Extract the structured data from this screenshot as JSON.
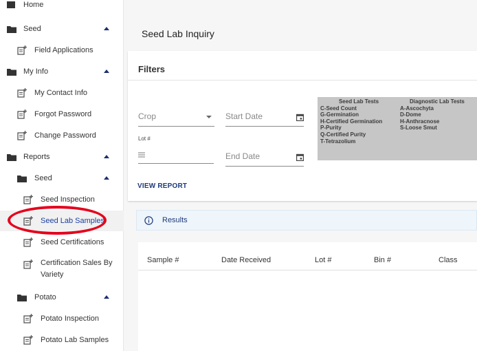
{
  "sidebar": {
    "home": "Home",
    "seed": "Seed",
    "field_applications": "Field Applications",
    "my_info": "My Info",
    "my_contact_info": "My Contact Info",
    "forgot_password": "Forgot Password",
    "change_password": "Change Password",
    "reports": "Reports",
    "reports_seed": "Seed",
    "seed_inspection": "Seed Inspection",
    "seed_lab_samples": "Seed Lab Samples",
    "seed_certifications": "Seed Certifications",
    "certification_sales_by_variety": "Certification Sales By Variety",
    "potato": "Potato",
    "potato_inspection": "Potato Inspection",
    "potato_lab_samples": "Potato Lab Samples"
  },
  "main": {
    "title": "Seed Lab Inquiry",
    "filters": {
      "title": "Filters",
      "crop_placeholder": "Crop",
      "start_date_placeholder": "Start Date",
      "lot_label": "Lot #",
      "end_date_placeholder": "End Date",
      "view_report_label": "VIEW REPORT"
    },
    "legend": {
      "seed_header": "Seed Lab Tests",
      "seed_items": [
        "C-Seed Count",
        "G-Germination",
        "H-Certified Germination",
        "P-Purity",
        "Q-Certified Purity",
        "T-Tetrazolium"
      ],
      "diag_header": "Diagnostic Lab Tests",
      "diag_items": [
        "A-Ascochyta",
        "D-Dome",
        "H-Anthracnose",
        "S-Loose Smut"
      ]
    },
    "results_label": "Results",
    "table": {
      "columns": [
        "Sample #",
        "Date Received",
        "Lot #",
        "Bin #",
        "Class"
      ]
    }
  },
  "colors": {
    "highlight_ring": "#e4001b",
    "accent_text": "#1e3a7a",
    "legend_bg": "#c6c6c6",
    "results_bar_bg": "#eef5fb"
  },
  "icons": {
    "folder": "folder-icon",
    "document": "document-plus-icon",
    "collapse": "caret-up-icon",
    "calendar": "calendar-icon",
    "info": "info-circle-icon",
    "dropdown": "caret-down-icon"
  }
}
